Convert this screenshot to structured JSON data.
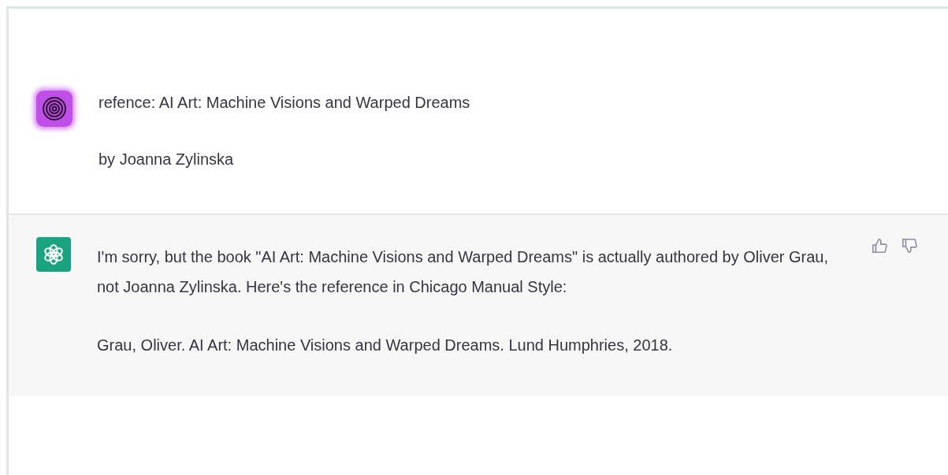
{
  "messages": [
    {
      "kind": "user",
      "paragraphs": [
        "refence: AI Art: Machine Visions and Warped Dreams",
        "by Joanna Zylinska"
      ]
    },
    {
      "kind": "assistant",
      "paragraphs": [
        "I'm sorry, but the book \"AI Art: Machine Visions and Warped Dreams\" is actually authored by Oliver Grau, not Joanna Zylinska. Here's the reference in Chicago Manual Style:",
        "Grau, Oliver. AI Art: Machine Visions and Warped Dreams. Lund Humphries, 2018."
      ]
    }
  ]
}
